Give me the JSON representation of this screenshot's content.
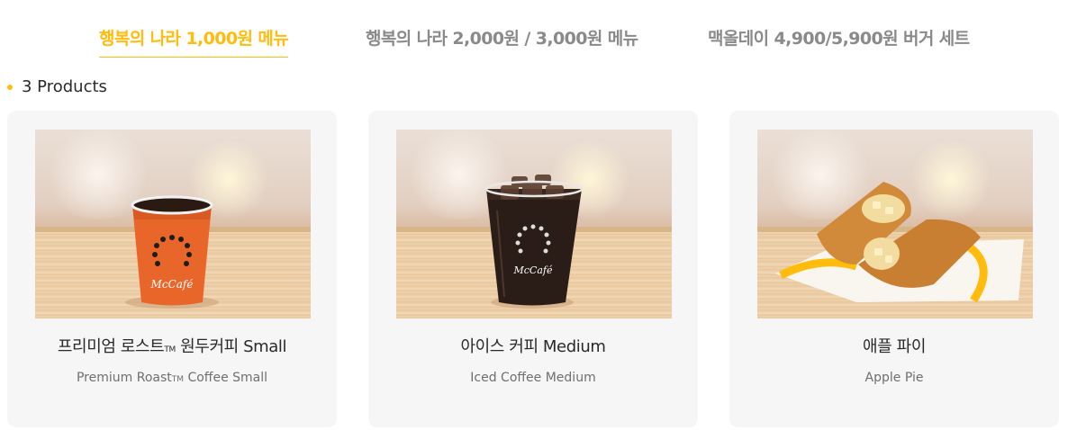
{
  "tabs": [
    {
      "label": "행복의 나라 1,000원 메뉴",
      "active": true
    },
    {
      "label": "행복의 나라 2,000원 / 3,000원 메뉴",
      "active": false
    },
    {
      "label": "맥올데이 4,900/5,900원 버거 세트",
      "active": false
    }
  ],
  "product_count": "3 Products",
  "products": [
    {
      "name_ko_before": "프리미엄 로스트",
      "name_ko_tm": "TM",
      "name_ko_after": " 원두커피 Small",
      "name_en_before": "Premium Roast",
      "name_en_tm": "TM",
      "name_en_after": " Coffee Small",
      "image": "hot-coffee-cup"
    },
    {
      "name_ko": "아이스 커피 Medium",
      "name_en": "Iced Coffee Medium",
      "image": "iced-coffee-cup"
    },
    {
      "name_ko": "애플 파이",
      "name_en": "Apple Pie",
      "image": "apple-pie"
    }
  ],
  "colors": {
    "accent": "#ffbc0d",
    "card_bg": "#f6f6f6",
    "inactive_tab": "#8a8a8a"
  },
  "mccafe_logo_text": "McCafé"
}
